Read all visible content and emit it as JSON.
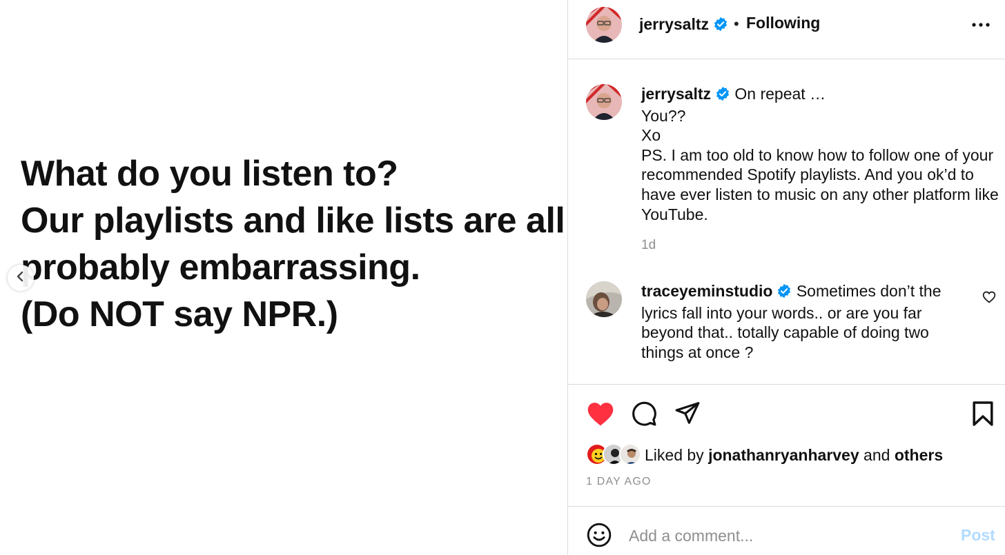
{
  "post": {
    "text_lines": [
      "What do you listen to?",
      "Our playlists and like lists are all",
      "probably embarrassing.",
      "(Do NOT say NPR.)"
    ]
  },
  "header": {
    "username": "jerrysaltz",
    "separator": "•",
    "following_label": "Following"
  },
  "caption": {
    "username": "jerrysaltz",
    "line1": "On repeat …",
    "line2": "You??",
    "line3": "Xo",
    "line4": "PS. I am too old to know how to follow one of your recommended Spotify playlists. And you ok’d to have ever listen to music on any other platform like YouTube.",
    "time": "1d"
  },
  "comment": {
    "username": "traceyeminstudio",
    "text": "Sometimes don’t the lyrics fall into your words.. or are you far beyond that.. totally capable of doing two things at once ?"
  },
  "likes": {
    "prefix": "Liked by",
    "user": "jonathanryanharvey",
    "conj": "and",
    "others": "others"
  },
  "timestamp": "1 DAY AGO",
  "compose": {
    "placeholder": "Add a comment...",
    "post_label": "Post"
  },
  "colors": {
    "like_red": "#ff3040",
    "verified_blue": "#0095f6",
    "post_button_disabled": "#b3dbff",
    "muted_text": "#8e8e8e"
  },
  "icons": [
    "chevron-left-icon",
    "verified-badge-icon",
    "more-options-icon",
    "heart-icon",
    "comment-icon",
    "share-icon",
    "bookmark-icon",
    "smiley-icon"
  ]
}
